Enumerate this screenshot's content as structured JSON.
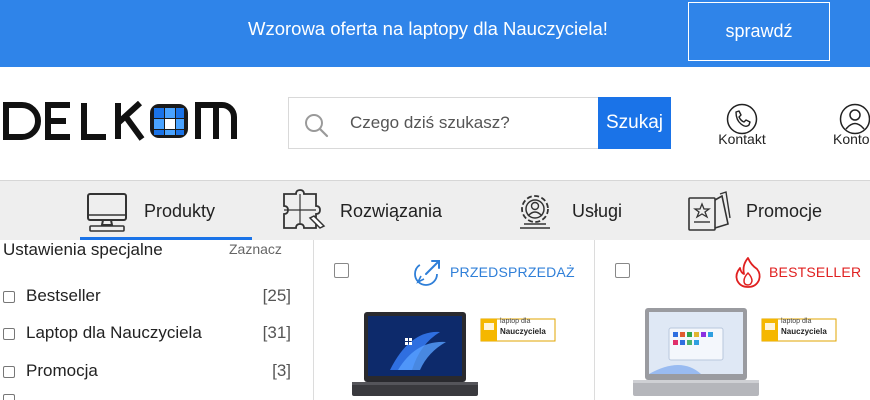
{
  "promo": {
    "text": "Wzorowa oferta na laptopy dla Nauczyciela!",
    "button": "sprawdź",
    "bg_color": "#2f84e9"
  },
  "header": {
    "logo": "DELKOM",
    "search_placeholder": "Czego dziś szukasz?",
    "search_button": "Szukaj",
    "contact_label": "Kontakt",
    "account_label": "Konto",
    "accent_color": "#1a73e8"
  },
  "nav": {
    "items": [
      {
        "label": "Produkty",
        "icon": "computer-icon",
        "active": true
      },
      {
        "label": "Rozwiązania",
        "icon": "puzzle-icon",
        "active": false
      },
      {
        "label": "Usługi",
        "icon": "gear-person-icon",
        "active": false
      },
      {
        "label": "Promocje",
        "icon": "tag-icon",
        "active": false
      }
    ]
  },
  "filters": {
    "title": "Ustawienia specjalne",
    "clear_label": "Zaznacz",
    "items": [
      {
        "label": "Bestseller",
        "count": "[25]"
      },
      {
        "label": "Laptop dla Nauczyciela",
        "count": "[31]"
      },
      {
        "label": "Promocja",
        "count": "[3]"
      }
    ]
  },
  "products": [
    {
      "badge": "PRZEDSPRZEDAŻ",
      "badge_icon": "rocket-icon",
      "badge_color": "#2f7fd8",
      "tag_line1": "laptop dla",
      "tag_line2": "Nauczyciela"
    },
    {
      "badge": "BESTSELLER",
      "badge_icon": "flame-icon",
      "badge_color": "#e02020",
      "tag_line1": "laptop dla",
      "tag_line2": "Nauczyciela"
    }
  ]
}
